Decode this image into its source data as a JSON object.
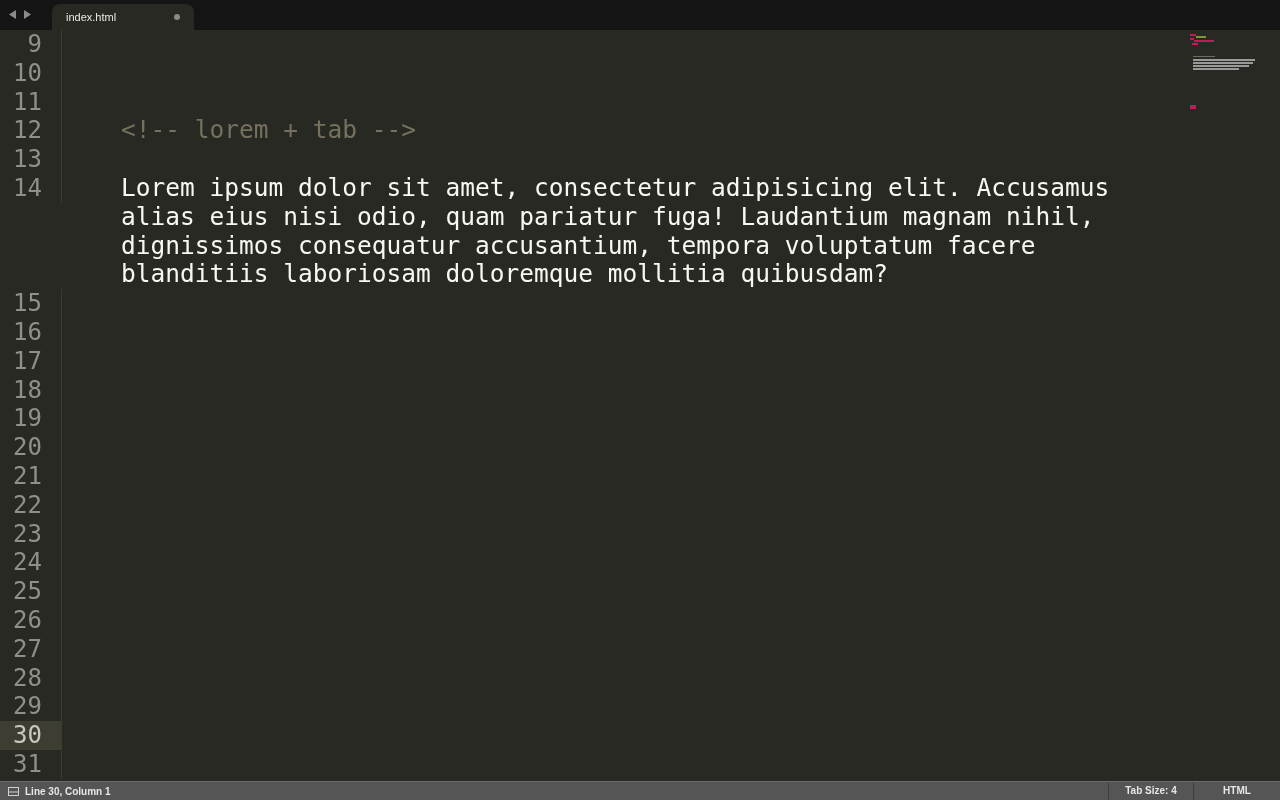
{
  "tabs": [
    {
      "label": "index.html",
      "selected": true,
      "modified": true
    }
  ],
  "lines": [
    {
      "number": "9",
      "kind": "blank",
      "current": false
    },
    {
      "number": "10",
      "kind": "blank",
      "current": false
    },
    {
      "number": "11",
      "kind": "blank",
      "current": false
    },
    {
      "number": "12",
      "kind": "comment",
      "text": "<!-- lorem + tab -->",
      "current": false
    },
    {
      "number": "13",
      "kind": "blank",
      "current": false
    },
    {
      "number": "14",
      "kind": "text",
      "text": "Lorem ipsum dolor sit amet, consectetur adipisicing elit. Accusamus alias eius nisi odio, quam pariatur fuga! Laudantium magnam nihil, dignissimos consequatur accusantium, tempora voluptatum facere blanditiis laboriosam doloremque mollitia quibusdam?",
      "current": false
    },
    {
      "number": "15",
      "kind": "blank",
      "current": false
    },
    {
      "number": "16",
      "kind": "blank",
      "current": false
    },
    {
      "number": "17",
      "kind": "blank",
      "current": false
    },
    {
      "number": "18",
      "kind": "blank",
      "current": false
    },
    {
      "number": "19",
      "kind": "blank",
      "current": false
    },
    {
      "number": "20",
      "kind": "blank",
      "current": false
    },
    {
      "number": "21",
      "kind": "blank",
      "current": false
    },
    {
      "number": "22",
      "kind": "blank",
      "current": false
    },
    {
      "number": "23",
      "kind": "blank",
      "current": false
    },
    {
      "number": "24",
      "kind": "blank",
      "current": false
    },
    {
      "number": "25",
      "kind": "blank",
      "current": false
    },
    {
      "number": "26",
      "kind": "blank",
      "current": false
    },
    {
      "number": "27",
      "kind": "blank",
      "current": false
    },
    {
      "number": "28",
      "kind": "blank",
      "current": false
    },
    {
      "number": "29",
      "kind": "blank",
      "current": false
    },
    {
      "number": "30",
      "kind": "blank",
      "current": true
    },
    {
      "number": "31",
      "kind": "blank",
      "current": false
    }
  ],
  "status_bar": {
    "position": "Line 30, Column 1",
    "tab_size": "Tab Size: 4",
    "syntax": "HTML"
  }
}
